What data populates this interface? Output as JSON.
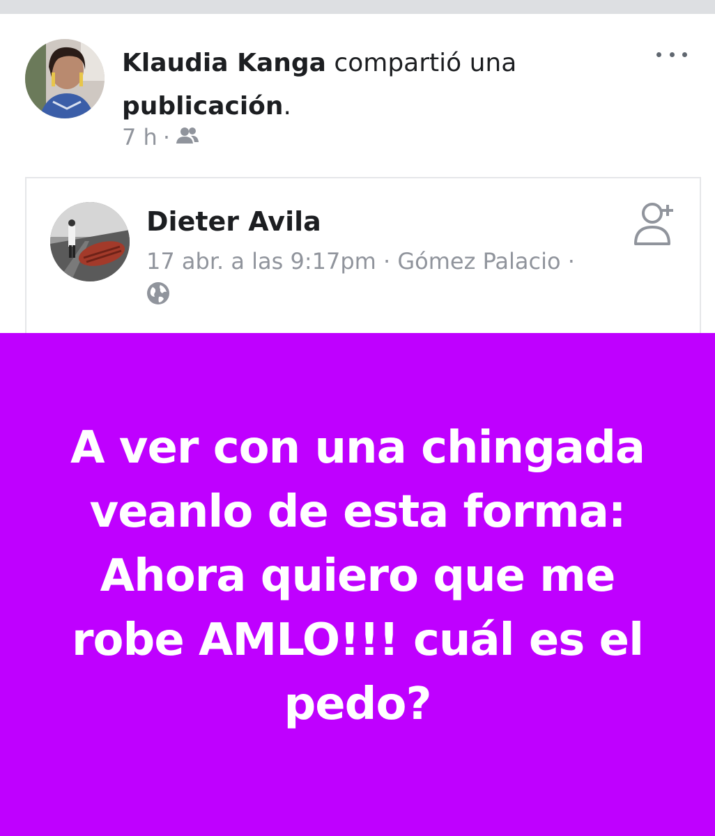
{
  "share": {
    "user_name": "Klaudia Kanga",
    "action_text": " compartió una ",
    "object_text": "publicación",
    "trailing": ".",
    "time": "7 h",
    "separator": "·",
    "audience_icon": "friends-icon"
  },
  "post": {
    "author": "Dieter Avila",
    "meta": "17 abr. a las 9:17pm · Gómez Palacio ·",
    "privacy_icon": "globe-icon",
    "add_friend_icon": "add-friend-icon",
    "text": "A ver con una chingada veanlo de esta forma: Ahora quiero que me robe AMLO!!! cuál es el pedo?",
    "background_color": "#bf00ff",
    "text_color": "#ffffff"
  },
  "menu": {
    "more_icon": "more-options-icon"
  }
}
